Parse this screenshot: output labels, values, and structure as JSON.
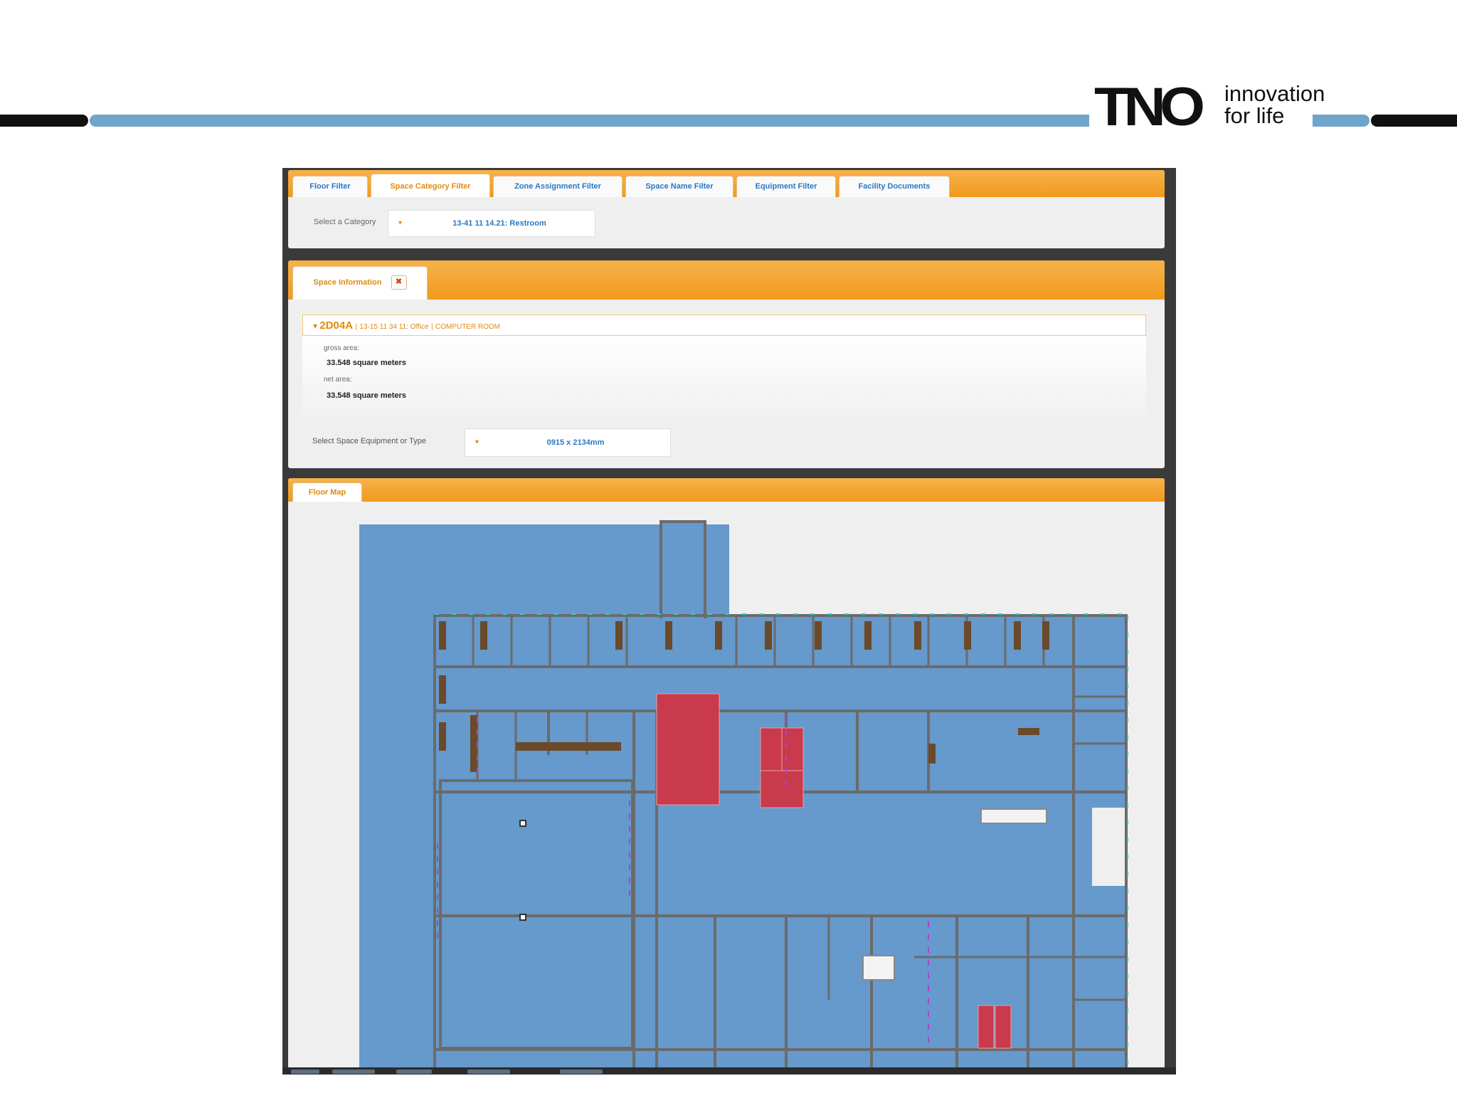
{
  "brand": {
    "logo_mark": "TNO",
    "tagline_line1": "innovation",
    "tagline_line2": "for life",
    "colors": {
      "band_blue": "#6fa4cb",
      "band_black": "#111111"
    }
  },
  "app": {
    "colors": {
      "tab_orange": "#f09a1e",
      "link_blue": "#2a78c5",
      "map_blue": "#6699cc",
      "highlight_red": "#c83a4c"
    },
    "filter_tabs": [
      {
        "label": "Floor Filter",
        "active": false
      },
      {
        "label": "Space Category Filter",
        "active": true
      },
      {
        "label": "Zone Assignment Filter",
        "active": false
      },
      {
        "label": "Space Name Filter",
        "active": false
      },
      {
        "label": "Equipment Filter",
        "active": false
      },
      {
        "label": "Facility Documents",
        "active": false
      }
    ],
    "category": {
      "label": "Select a Category",
      "caret": "▾",
      "value": "13-41 11 14.21: Restroom"
    },
    "space_info": {
      "tab_label": "Space Information",
      "close_glyph": "✖",
      "space_id": "2D04A",
      "space_category": "13-15 11 34 11: Office",
      "space_name": "COMPUTER ROOM",
      "expand_glyph": "▾",
      "separator": "|",
      "gross_area_label": "gross area:",
      "gross_area_value": "33.548 square meters",
      "net_area_label": "net area:",
      "net_area_value": "33.548 square meters",
      "equipment_label": "Select Space Equipment or Type",
      "equipment_caret": "▾",
      "equipment_value": "0915 x 2134mm"
    },
    "floor_map": {
      "tab_label": "Floor Map"
    }
  }
}
